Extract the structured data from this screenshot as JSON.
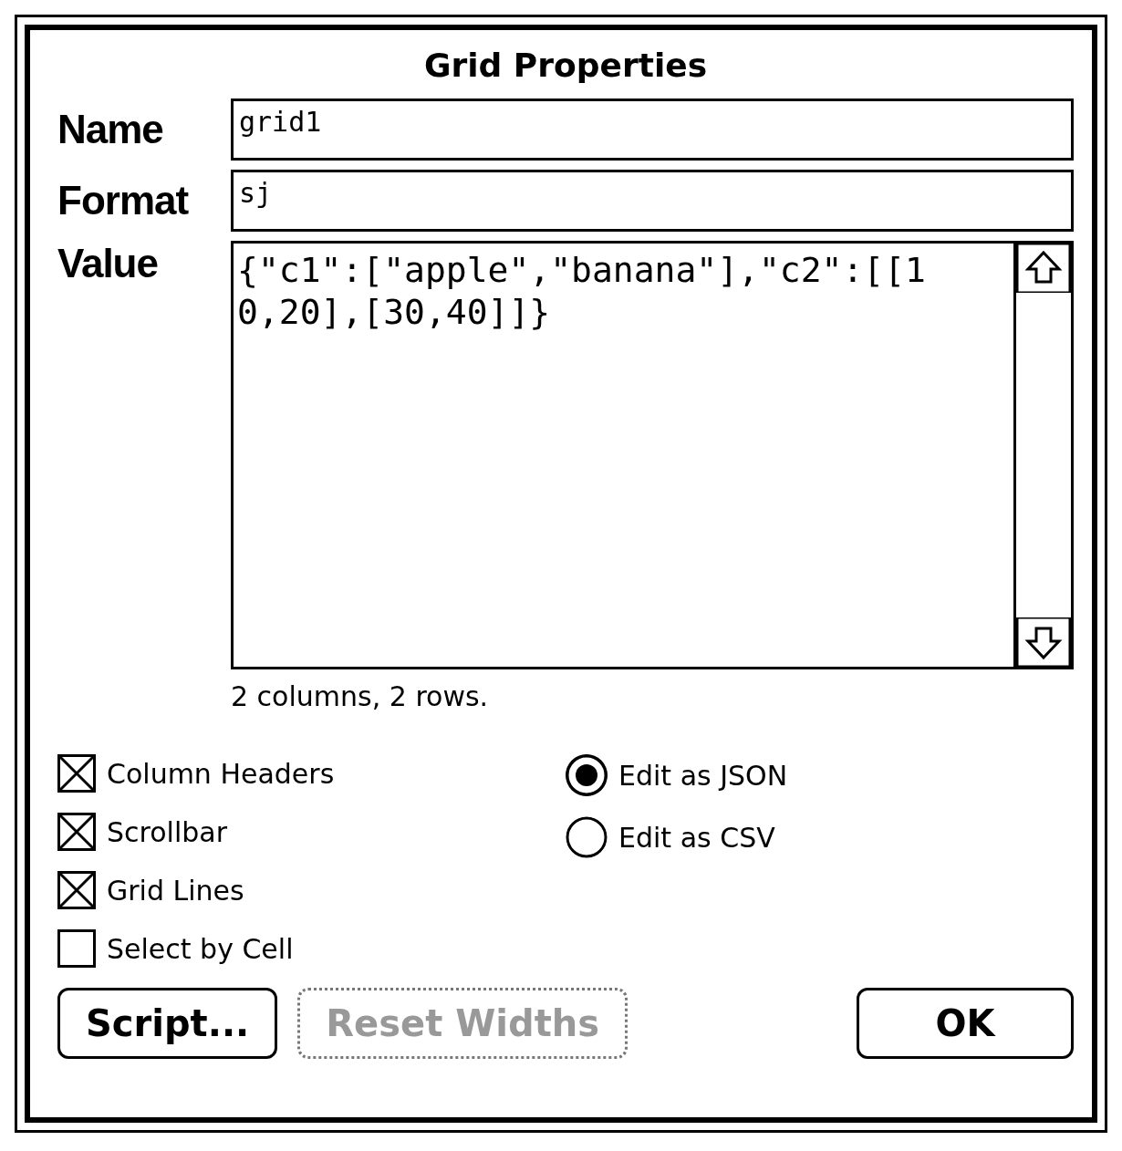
{
  "window": {
    "title": "Grid Properties"
  },
  "fields": [
    {
      "label": "Name",
      "value": "grid1"
    },
    {
      "label": "Format",
      "value": "sj"
    }
  ],
  "value_field": {
    "label": "Value",
    "value": "{\"c1\":[\"apple\",\"banana\"],\"c2\":[[10,20],[30,40]]}"
  },
  "status": "2 columns, 2 rows.",
  "checkboxes": [
    {
      "label": "Column Headers",
      "checked": true
    },
    {
      "label": "Scrollbar",
      "checked": true
    },
    {
      "label": "Grid Lines",
      "checked": true
    },
    {
      "label": "Select by Cell",
      "checked": false
    }
  ],
  "radios": [
    {
      "label": "Edit as JSON",
      "selected": true
    },
    {
      "label": "Edit as CSV",
      "selected": false
    }
  ],
  "buttons": [
    {
      "label": "Script...",
      "disabled": false
    },
    {
      "label": "Reset Widths",
      "disabled": true
    },
    {
      "label": "OK",
      "disabled": false
    }
  ]
}
